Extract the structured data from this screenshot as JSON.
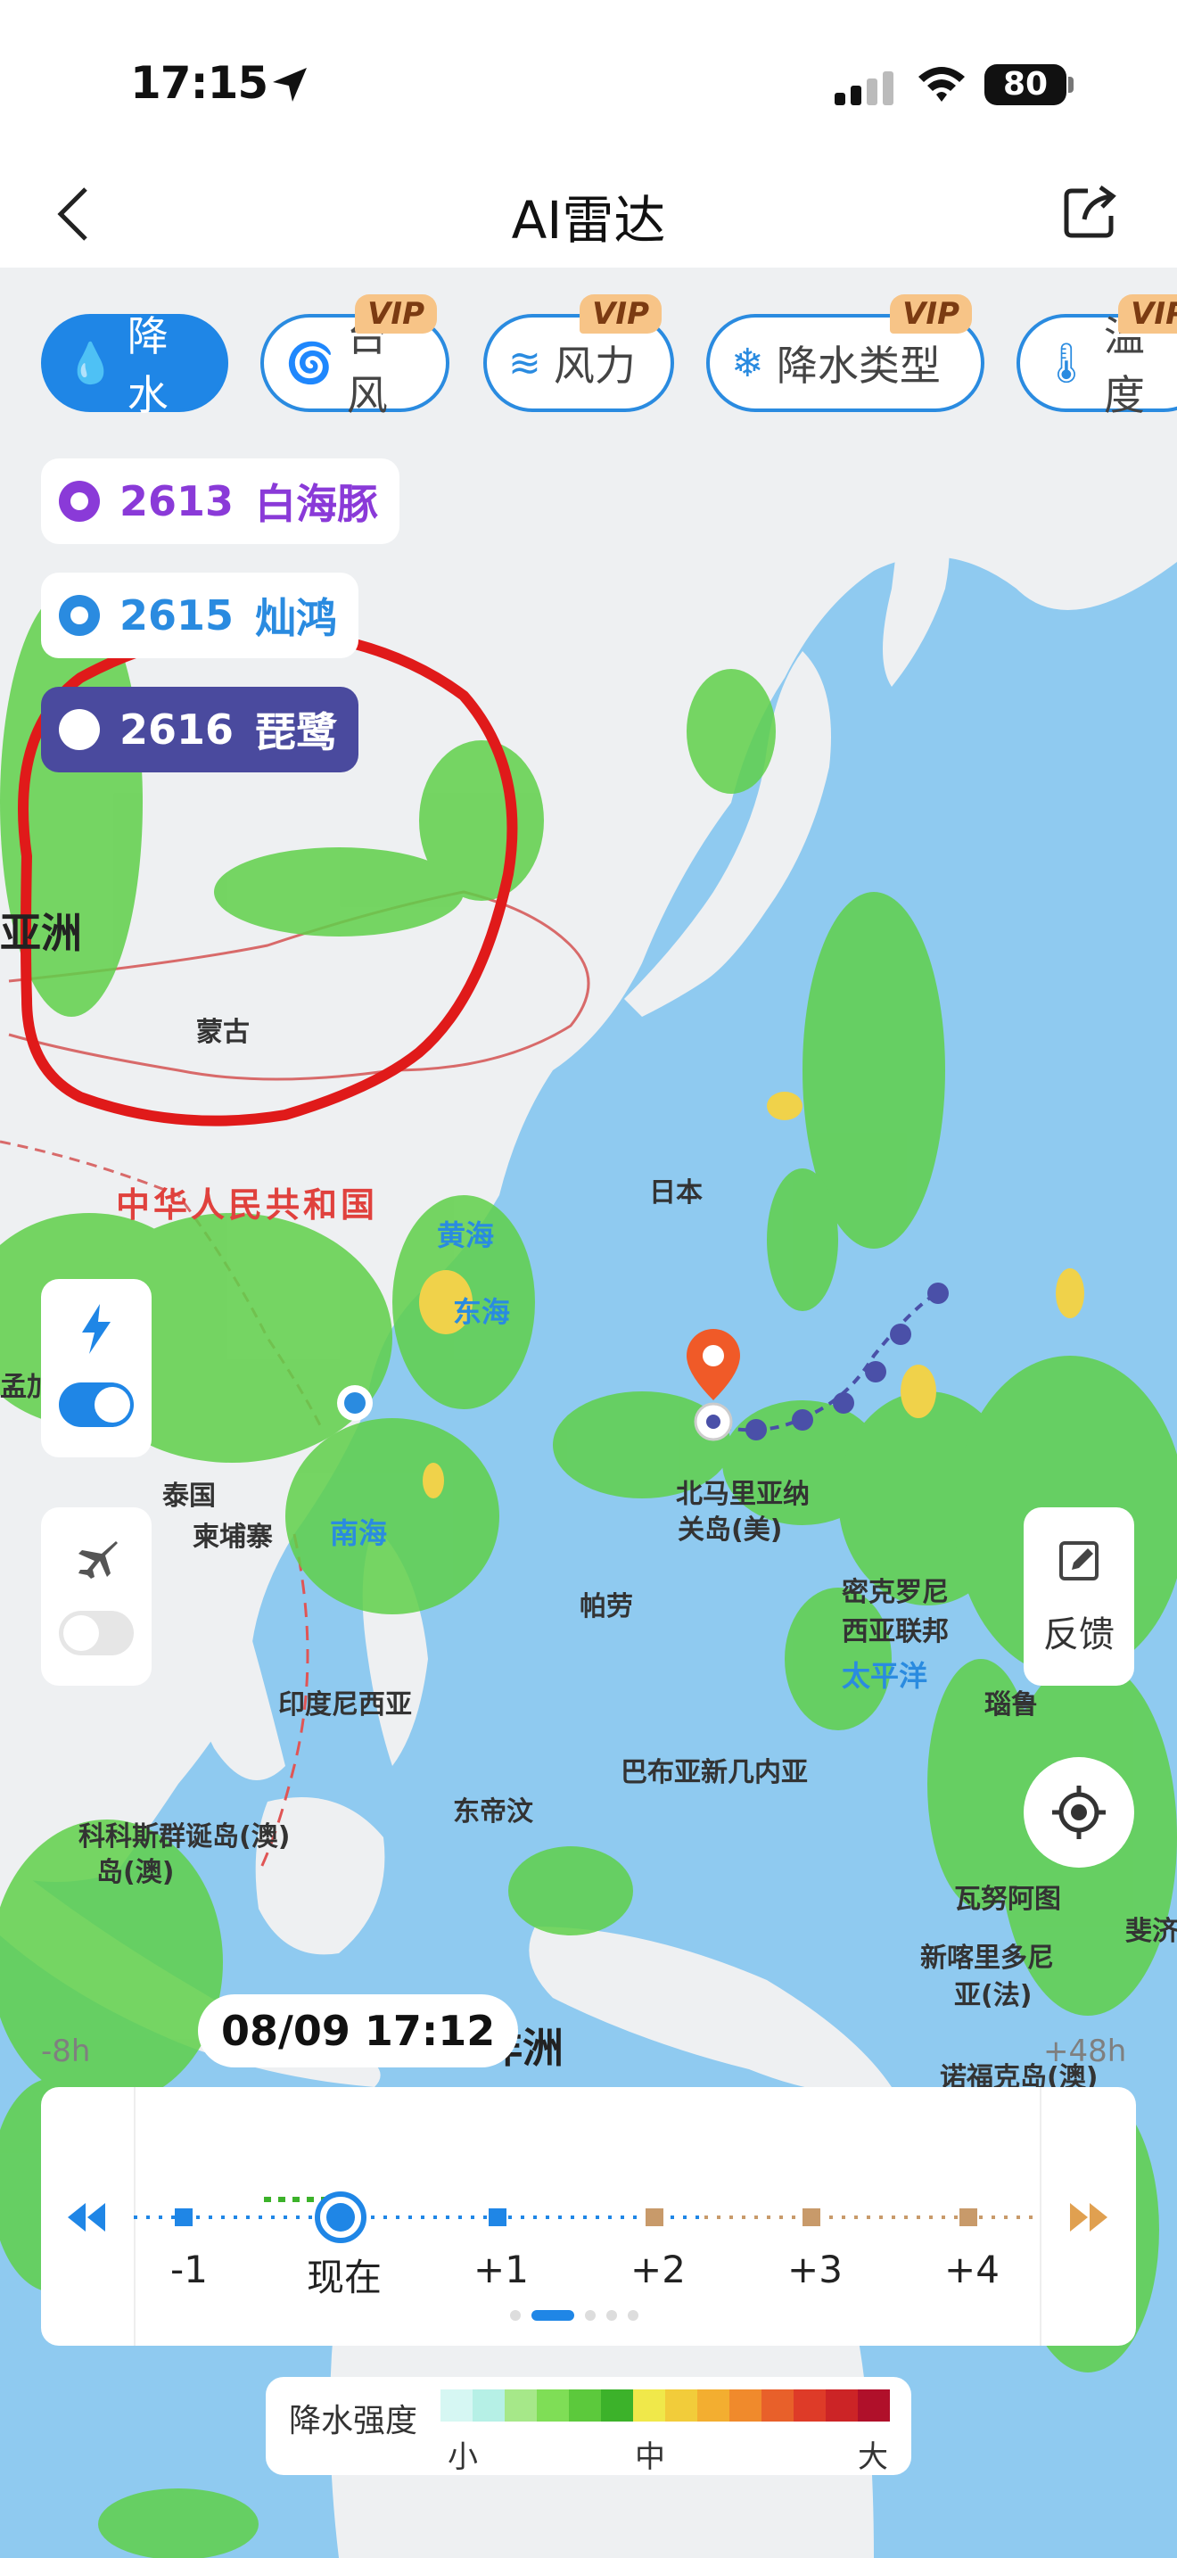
{
  "status_bar": {
    "time": "17:15",
    "battery": "80"
  },
  "nav": {
    "title": "AI雷达"
  },
  "layers": [
    {
      "label": "降水",
      "active": true
    },
    {
      "label": "台风",
      "vip": "VIP"
    },
    {
      "label": "风力",
      "vip": "VIP"
    },
    {
      "label": "降水类型",
      "vip": "VIP"
    },
    {
      "label": "温度",
      "vip": "VIP"
    }
  ],
  "typhoons": [
    {
      "id": "2613",
      "name": "白海豚",
      "color": "#8a3ad8"
    },
    {
      "id": "2615",
      "name": "灿鸿",
      "color": "#2a8be0"
    },
    {
      "id": "2616",
      "name": "琵鹭",
      "color": "#4a4a9e"
    }
  ],
  "map_labels": {
    "asia": "亚洲",
    "mongolia": "蒙古",
    "china": "中华人民共和国",
    "yellow_sea": "黄海",
    "east_sea": "东海",
    "japan": "日本",
    "northern_mariana": "北马里亚纳",
    "guam": "关岛(美)",
    "thailand": "泰国",
    "cambodia": "柬埔寨",
    "south_sea": "南海",
    "palau": "帕劳",
    "micronesia_1": "密克罗尼",
    "micronesia_2": "西亚联邦",
    "pacific": "太平洋",
    "nauru": "瑙鲁",
    "indonesia": "印度尼西亚",
    "east_timor": "东帝汶",
    "png": "巴布亚新几内亚",
    "cocos_1": "科科斯群诞岛(澳)",
    "cocos_2": "岛(澳)",
    "vanuatu": "瓦努阿图",
    "fiji": "斐济",
    "new_caledonia_1": "新喀里多尼",
    "new_caledonia_2": "亚(法)",
    "norfolk": "诺福克岛(澳)",
    "australia": "洋洲",
    "meng": "孟加"
  },
  "feedback_label": "反馈",
  "timeline": {
    "current_time": "08/09 17:12",
    "left_tag": "-8h",
    "right_tag": "+48h",
    "ticks": [
      "-1",
      "现在",
      "+1",
      "+2",
      "+3",
      "+4"
    ]
  },
  "legend": {
    "title": "降水强度",
    "low": "小",
    "mid": "中",
    "high": "大",
    "colors": [
      "#d6f7f3",
      "#b6f0e6",
      "#a6e889",
      "#7fde56",
      "#5cc93c",
      "#3cb22a",
      "#f0e84a",
      "#f2cc3a",
      "#f3ae30",
      "#f08a2c",
      "#e8602a",
      "#de3b28",
      "#cc2426",
      "#b0102a"
    ]
  }
}
